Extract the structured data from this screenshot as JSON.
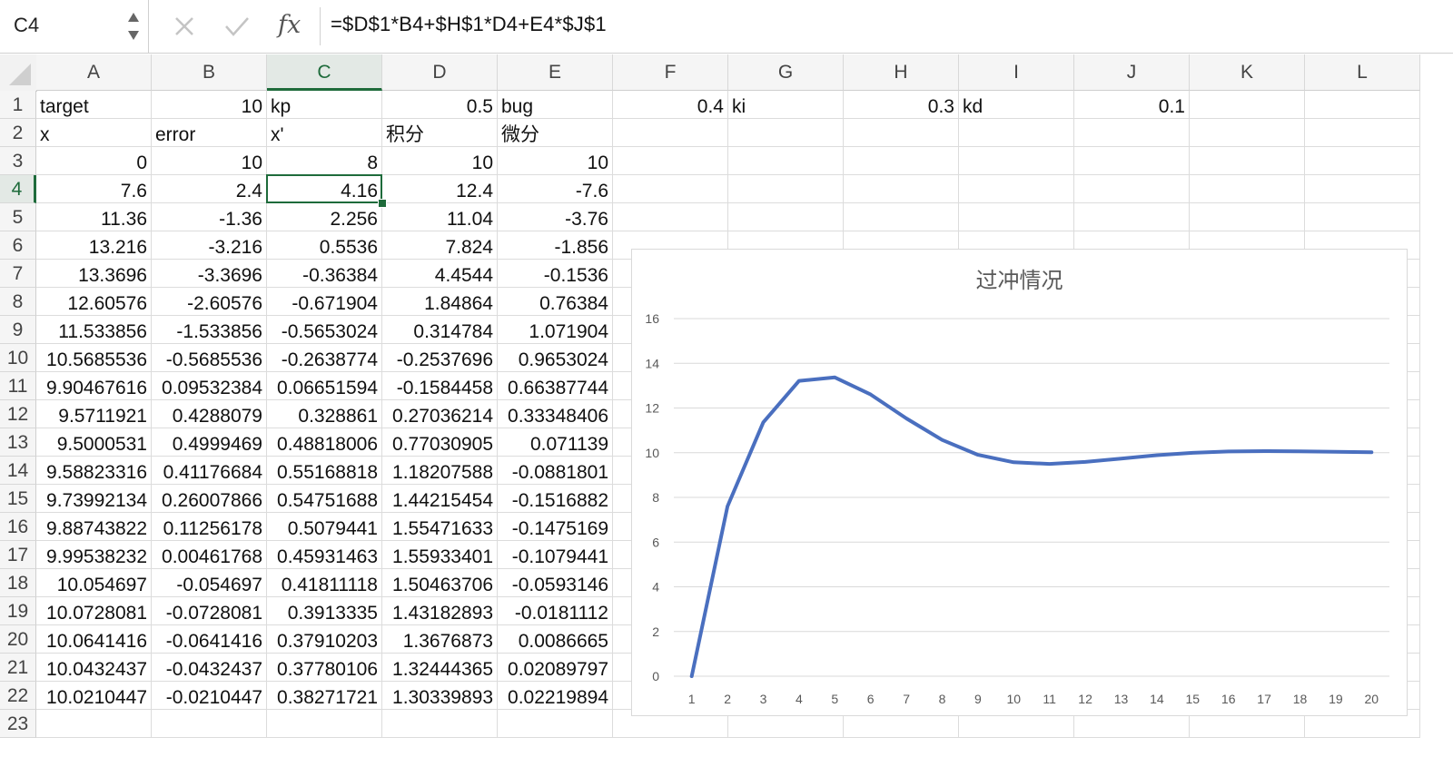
{
  "name_box": "C4",
  "formula": "=$D$1*B4+$H$1*D4+E4*$J$1",
  "icons": {
    "cancel": "cancel-x-icon",
    "confirm": "confirm-check-icon",
    "fx": "fx-function-icon"
  },
  "fx_label": "fx",
  "columns": [
    "A",
    "B",
    "C",
    "D",
    "E",
    "F",
    "G",
    "H",
    "I",
    "J",
    "K",
    "L"
  ],
  "selected_column": "C",
  "selected_row": 4,
  "rows": [
    {
      "n": "1",
      "c": [
        "target",
        "10",
        "kp",
        "0.5",
        "bug",
        "0.4",
        "ki",
        "0.3",
        "kd",
        "0.1",
        "",
        ""
      ]
    },
    {
      "n": "2",
      "c": [
        "x",
        "error",
        "x'",
        "积分",
        "微分",
        "",
        "",
        "",
        "",
        "",
        "",
        ""
      ]
    },
    {
      "n": "3",
      "c": [
        "0",
        "10",
        "8",
        "10",
        "10",
        "",
        "",
        "",
        "",
        "",
        "",
        ""
      ]
    },
    {
      "n": "4",
      "c": [
        "7.6",
        "2.4",
        "4.16",
        "12.4",
        "-7.6",
        "",
        "",
        "",
        "",
        "",
        "",
        ""
      ]
    },
    {
      "n": "5",
      "c": [
        "11.36",
        "-1.36",
        "2.256",
        "11.04",
        "-3.76",
        "",
        "",
        "",
        "",
        "",
        "",
        ""
      ]
    },
    {
      "n": "6",
      "c": [
        "13.216",
        "-3.216",
        "0.5536",
        "7.824",
        "-1.856",
        "",
        "",
        "",
        "",
        "",
        "",
        ""
      ]
    },
    {
      "n": "7",
      "c": [
        "13.3696",
        "-3.3696",
        "-0.36384",
        "4.4544",
        "-0.1536",
        "",
        "",
        "",
        "",
        "",
        "",
        ""
      ]
    },
    {
      "n": "8",
      "c": [
        "12.60576",
        "-2.60576",
        "-0.671904",
        "1.84864",
        "0.76384",
        "",
        "",
        "",
        "",
        "",
        "",
        ""
      ]
    },
    {
      "n": "9",
      "c": [
        "11.533856",
        "-1.533856",
        "-0.5653024",
        "0.314784",
        "1.071904",
        "",
        "",
        "",
        "",
        "",
        "",
        ""
      ]
    },
    {
      "n": "10",
      "c": [
        "10.5685536",
        "-0.5685536",
        "-0.2638774",
        "-0.2537696",
        "0.9653024",
        "",
        "",
        "",
        "",
        "",
        "",
        ""
      ]
    },
    {
      "n": "11",
      "c": [
        "9.90467616",
        "0.09532384",
        "0.06651594",
        "-0.1584458",
        "0.66387744",
        "",
        "",
        "",
        "",
        "",
        "",
        ""
      ]
    },
    {
      "n": "12",
      "c": [
        "9.5711921",
        "0.4288079",
        "0.328861",
        "0.27036214",
        "0.33348406",
        "",
        "",
        "",
        "",
        "",
        "",
        ""
      ]
    },
    {
      "n": "13",
      "c": [
        "9.5000531",
        "0.4999469",
        "0.48818006",
        "0.77030905",
        "0.071139",
        "",
        "",
        "",
        "",
        "",
        "",
        ""
      ]
    },
    {
      "n": "14",
      "c": [
        "9.58823316",
        "0.41176684",
        "0.55168818",
        "1.18207588",
        "-0.0881801",
        "",
        "",
        "",
        "",
        "",
        "",
        ""
      ]
    },
    {
      "n": "15",
      "c": [
        "9.73992134",
        "0.26007866",
        "0.54751688",
        "1.44215454",
        "-0.1516882",
        "",
        "",
        "",
        "",
        "",
        "",
        ""
      ]
    },
    {
      "n": "16",
      "c": [
        "9.88743822",
        "0.11256178",
        "0.5079441",
        "1.55471633",
        "-0.1475169",
        "",
        "",
        "",
        "",
        "",
        "",
        ""
      ]
    },
    {
      "n": "17",
      "c": [
        "9.99538232",
        "0.00461768",
        "0.45931463",
        "1.55933401",
        "-0.1079441",
        "",
        "",
        "",
        "",
        "",
        "",
        ""
      ]
    },
    {
      "n": "18",
      "c": [
        "10.054697",
        "-0.054697",
        "0.41811118",
        "1.50463706",
        "-0.0593146",
        "",
        "",
        "",
        "",
        "",
        "",
        ""
      ]
    },
    {
      "n": "19",
      "c": [
        "10.0728081",
        "-0.0728081",
        "0.3913335",
        "1.43182893",
        "-0.0181112",
        "",
        "",
        "",
        "",
        "",
        "",
        ""
      ]
    },
    {
      "n": "20",
      "c": [
        "10.0641416",
        "-0.0641416",
        "0.37910203",
        "1.3676873",
        "0.0086665",
        "",
        "",
        "",
        "",
        "",
        "",
        ""
      ]
    },
    {
      "n": "21",
      "c": [
        "10.0432437",
        "-0.0432437",
        "0.37780106",
        "1.32444365",
        "0.02089797",
        "",
        "",
        "",
        "",
        "",
        "",
        ""
      ]
    },
    {
      "n": "22",
      "c": [
        "10.0210447",
        "-0.0210447",
        "0.38271721",
        "1.30339893",
        "0.02219894",
        "",
        "",
        "",
        "",
        "",
        "",
        ""
      ]
    },
    {
      "n": "23",
      "c": [
        "",
        "",
        "",
        "",
        "",
        "",
        "",
        "",
        "",
        "",
        "",
        ""
      ]
    }
  ],
  "chart_data": {
    "type": "line",
    "title": "过冲情况",
    "x": [
      1,
      2,
      3,
      4,
      5,
      6,
      7,
      8,
      9,
      10,
      11,
      12,
      13,
      14,
      15,
      16,
      17,
      18,
      19,
      20
    ],
    "series": [
      {
        "values": [
          0,
          7.6,
          11.36,
          13.216,
          13.3696,
          12.60576,
          11.533856,
          10.5685536,
          9.90467616,
          9.5711921,
          9.5000531,
          9.58823316,
          9.73992134,
          9.88743822,
          9.99538232,
          10.054697,
          10.0728081,
          10.0641416,
          10.0432437,
          10.0210447
        ],
        "color": "#4a6fbf"
      }
    ],
    "ylim": [
      0,
      16
    ],
    "yticks": [
      0,
      2,
      4,
      6,
      8,
      10,
      12,
      14,
      16
    ],
    "grid": true,
    "legend": "none"
  }
}
